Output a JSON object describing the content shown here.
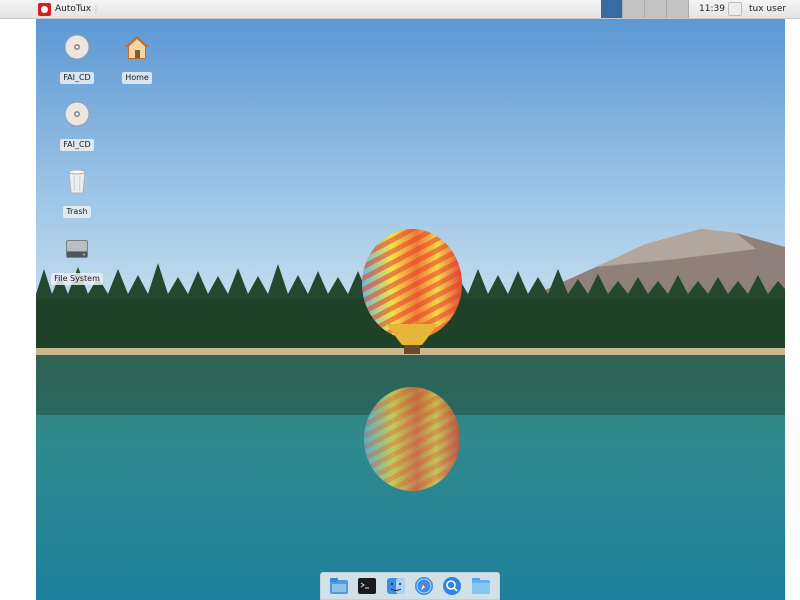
{
  "top_panel": {
    "menu_label": "AutoTux",
    "separator": "⋮",
    "workspaces": [
      {
        "active": true
      },
      {
        "active": false
      },
      {
        "active": false
      },
      {
        "active": false
      }
    ],
    "clock": "11:39",
    "user": "tux user"
  },
  "desktop_icons": [
    {
      "label": "FAI_CD",
      "icon": "cd-drive-icon"
    },
    {
      "label": "Home",
      "icon": "home-folder-icon"
    },
    {
      "label": "FAI_CD",
      "icon": "cd-drive-icon"
    },
    {
      "label": "Trash",
      "icon": "trash-icon"
    },
    {
      "label": "File System",
      "icon": "hard-drive-icon"
    }
  ],
  "dock": [
    {
      "icon": "file-manager-icon"
    },
    {
      "icon": "terminal-icon"
    },
    {
      "icon": "finder-icon"
    },
    {
      "icon": "web-browser-icon"
    },
    {
      "icon": "search-icon"
    },
    {
      "icon": "folder-icon"
    }
  ],
  "colors": {
    "accent_red": "#d11f26",
    "active_workspace": "#3a6aa6",
    "inactive_workspace": "#c2c2c2"
  }
}
